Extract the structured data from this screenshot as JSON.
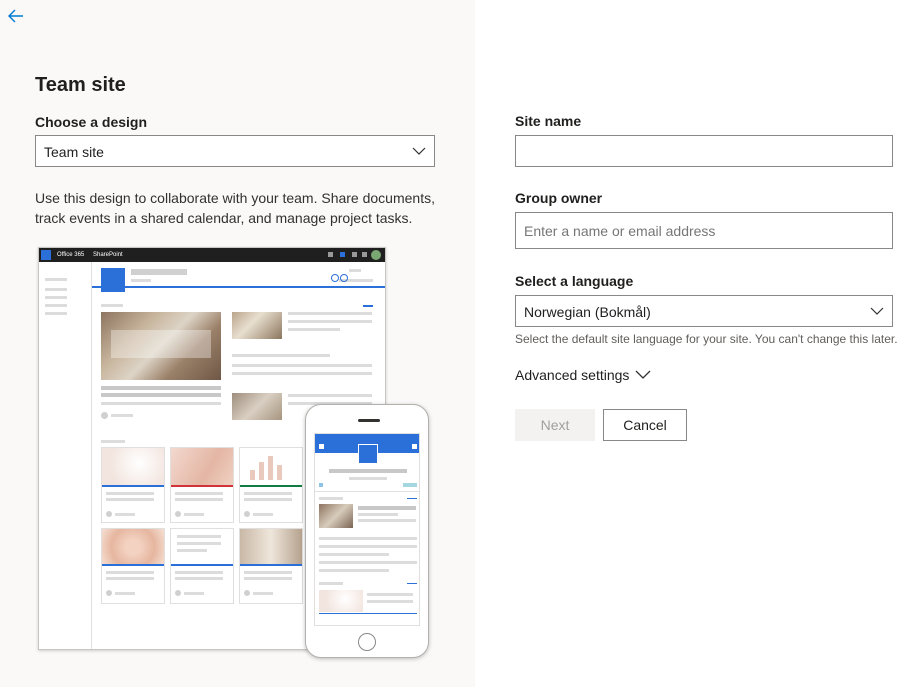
{
  "left": {
    "title": "Team site",
    "design_label": "Choose a design",
    "design_value": "Team site",
    "description": "Use this design to collaborate with your team. Share documents, track events in a shared calendar, and manage project tasks.",
    "preview": {
      "office_label": "Office 365",
      "sharepoint_label": "SharePoint"
    }
  },
  "form": {
    "site_name_label": "Site name",
    "site_name_value": "",
    "group_owner_label": "Group owner",
    "group_owner_placeholder": "Enter a name or email address",
    "language_label": "Select a language",
    "language_value": "Norwegian (Bokmål)",
    "language_helper": "Select the default site language for your site. You can't change this later.",
    "advanced_label": "Advanced settings",
    "next_label": "Next",
    "cancel_label": "Cancel"
  },
  "colors": {
    "left_bg": "#faf9f8",
    "accent": "#0078d4",
    "border": "#8a8886"
  },
  "icons": {
    "back": "arrow-left-icon",
    "dropdown": "chevron-down-icon"
  }
}
